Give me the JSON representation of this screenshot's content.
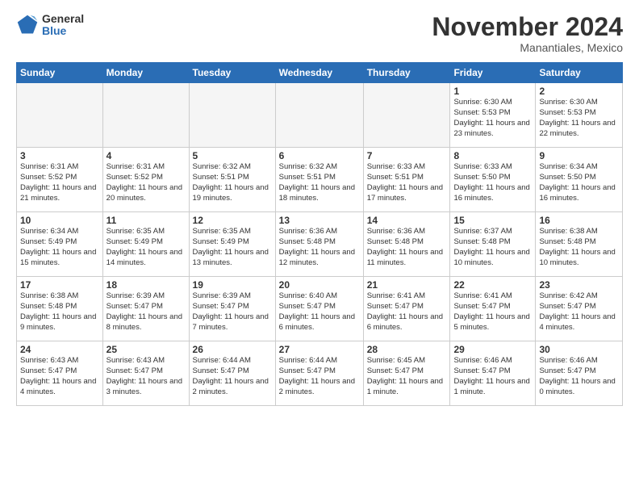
{
  "header": {
    "logo_general": "General",
    "logo_blue": "Blue",
    "title": "November 2024",
    "location": "Manantiales, Mexico"
  },
  "days_of_week": [
    "Sunday",
    "Monday",
    "Tuesday",
    "Wednesday",
    "Thursday",
    "Friday",
    "Saturday"
  ],
  "weeks": [
    [
      {
        "day": "",
        "empty": true
      },
      {
        "day": "",
        "empty": true
      },
      {
        "day": "",
        "empty": true
      },
      {
        "day": "",
        "empty": true
      },
      {
        "day": "",
        "empty": true
      },
      {
        "day": "1",
        "sunrise": "6:30 AM",
        "sunset": "5:53 PM",
        "daylight": "11 hours and 23 minutes."
      },
      {
        "day": "2",
        "sunrise": "6:30 AM",
        "sunset": "5:53 PM",
        "daylight": "11 hours and 22 minutes."
      }
    ],
    [
      {
        "day": "3",
        "sunrise": "6:31 AM",
        "sunset": "5:52 PM",
        "daylight": "11 hours and 21 minutes."
      },
      {
        "day": "4",
        "sunrise": "6:31 AM",
        "sunset": "5:52 PM",
        "daylight": "11 hours and 20 minutes."
      },
      {
        "day": "5",
        "sunrise": "6:32 AM",
        "sunset": "5:51 PM",
        "daylight": "11 hours and 19 minutes."
      },
      {
        "day": "6",
        "sunrise": "6:32 AM",
        "sunset": "5:51 PM",
        "daylight": "11 hours and 18 minutes."
      },
      {
        "day": "7",
        "sunrise": "6:33 AM",
        "sunset": "5:51 PM",
        "daylight": "11 hours and 17 minutes."
      },
      {
        "day": "8",
        "sunrise": "6:33 AM",
        "sunset": "5:50 PM",
        "daylight": "11 hours and 16 minutes."
      },
      {
        "day": "9",
        "sunrise": "6:34 AM",
        "sunset": "5:50 PM",
        "daylight": "11 hours and 16 minutes."
      }
    ],
    [
      {
        "day": "10",
        "sunrise": "6:34 AM",
        "sunset": "5:49 PM",
        "daylight": "11 hours and 15 minutes."
      },
      {
        "day": "11",
        "sunrise": "6:35 AM",
        "sunset": "5:49 PM",
        "daylight": "11 hours and 14 minutes."
      },
      {
        "day": "12",
        "sunrise": "6:35 AM",
        "sunset": "5:49 PM",
        "daylight": "11 hours and 13 minutes."
      },
      {
        "day": "13",
        "sunrise": "6:36 AM",
        "sunset": "5:48 PM",
        "daylight": "11 hours and 12 minutes."
      },
      {
        "day": "14",
        "sunrise": "6:36 AM",
        "sunset": "5:48 PM",
        "daylight": "11 hours and 11 minutes."
      },
      {
        "day": "15",
        "sunrise": "6:37 AM",
        "sunset": "5:48 PM",
        "daylight": "11 hours and 10 minutes."
      },
      {
        "day": "16",
        "sunrise": "6:38 AM",
        "sunset": "5:48 PM",
        "daylight": "11 hours and 10 minutes."
      }
    ],
    [
      {
        "day": "17",
        "sunrise": "6:38 AM",
        "sunset": "5:48 PM",
        "daylight": "11 hours and 9 minutes."
      },
      {
        "day": "18",
        "sunrise": "6:39 AM",
        "sunset": "5:47 PM",
        "daylight": "11 hours and 8 minutes."
      },
      {
        "day": "19",
        "sunrise": "6:39 AM",
        "sunset": "5:47 PM",
        "daylight": "11 hours and 7 minutes."
      },
      {
        "day": "20",
        "sunrise": "6:40 AM",
        "sunset": "5:47 PM",
        "daylight": "11 hours and 6 minutes."
      },
      {
        "day": "21",
        "sunrise": "6:41 AM",
        "sunset": "5:47 PM",
        "daylight": "11 hours and 6 minutes."
      },
      {
        "day": "22",
        "sunrise": "6:41 AM",
        "sunset": "5:47 PM",
        "daylight": "11 hours and 5 minutes."
      },
      {
        "day": "23",
        "sunrise": "6:42 AM",
        "sunset": "5:47 PM",
        "daylight": "11 hours and 4 minutes."
      }
    ],
    [
      {
        "day": "24",
        "sunrise": "6:43 AM",
        "sunset": "5:47 PM",
        "daylight": "11 hours and 4 minutes."
      },
      {
        "day": "25",
        "sunrise": "6:43 AM",
        "sunset": "5:47 PM",
        "daylight": "11 hours and 3 minutes."
      },
      {
        "day": "26",
        "sunrise": "6:44 AM",
        "sunset": "5:47 PM",
        "daylight": "11 hours and 2 minutes."
      },
      {
        "day": "27",
        "sunrise": "6:44 AM",
        "sunset": "5:47 PM",
        "daylight": "11 hours and 2 minutes."
      },
      {
        "day": "28",
        "sunrise": "6:45 AM",
        "sunset": "5:47 PM",
        "daylight": "11 hours and 1 minute."
      },
      {
        "day": "29",
        "sunrise": "6:46 AM",
        "sunset": "5:47 PM",
        "daylight": "11 hours and 1 minute."
      },
      {
        "day": "30",
        "sunrise": "6:46 AM",
        "sunset": "5:47 PM",
        "daylight": "11 hours and 0 minutes."
      }
    ]
  ]
}
